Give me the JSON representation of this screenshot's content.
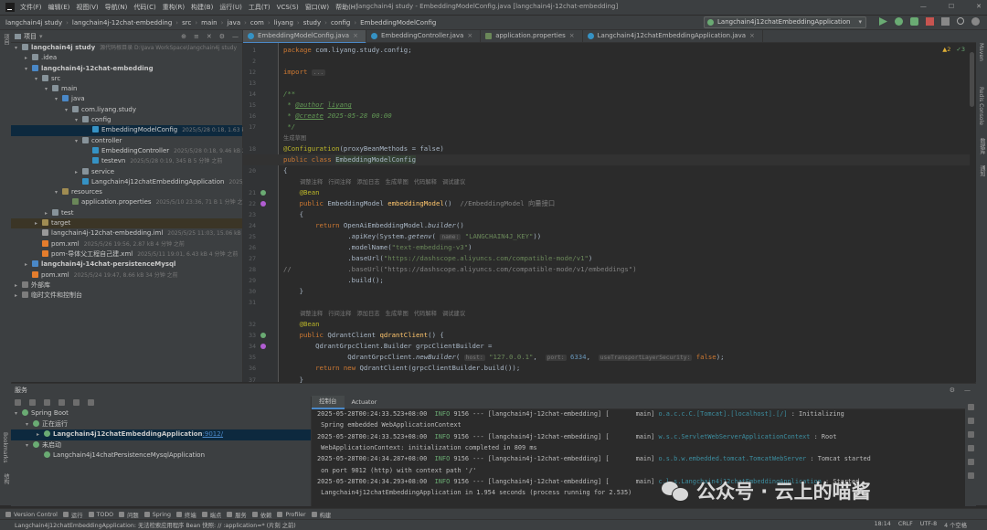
{
  "topbar": {
    "menu": [
      "文件(F)",
      "编辑(E)",
      "视图(V)",
      "导航(N)",
      "代码(C)",
      "重构(R)",
      "构建(B)",
      "运行(U)",
      "工具(T)",
      "VCS(S)",
      "窗口(W)",
      "帮助(H)"
    ],
    "title": "langchain4j study - EmbeddingModelConfig.java [langchain4j-12chat-embedding]"
  },
  "breadcrumb": [
    "langchain4j study",
    "langchain4j-12chat-embedding",
    "src",
    "main",
    "java",
    "com",
    "liyang",
    "study",
    "config",
    "EmbeddingModelConfig"
  ],
  "run_config": "Langchain4j12chatEmbeddingApplication",
  "project": {
    "header": "项目",
    "rows": [
      {
        "label": "langchain4j study",
        "meta": "源代码根目录  D:\\Java WorkSpace\\langchain4j study",
        "indent": 0,
        "arrow": "▾",
        "icon": "folder",
        "bold": true
      },
      {
        "label": ".idea",
        "meta": "",
        "indent": 1,
        "arrow": "▸",
        "icon": "folder"
      },
      {
        "label": "langchain4j-12chat-embedding",
        "meta": "",
        "indent": 1,
        "arrow": "▾",
        "icon": "mod",
        "bold": true
      },
      {
        "label": "src",
        "meta": "",
        "indent": 2,
        "arrow": "▾",
        "icon": "folder"
      },
      {
        "label": "main",
        "meta": "",
        "indent": 3,
        "arrow": "▾",
        "icon": "folder"
      },
      {
        "label": "java",
        "meta": "",
        "indent": 4,
        "arrow": "▾",
        "icon": "src"
      },
      {
        "label": "com.liyang.study",
        "meta": "",
        "indent": 5,
        "arrow": "▾",
        "icon": "folder"
      },
      {
        "label": "config",
        "meta": "",
        "indent": 6,
        "arrow": "▾",
        "icon": "folder"
      },
      {
        "label": "EmbeddingModelConfig",
        "meta": "2025/5/28 0:18, 1.63 kB 2 分钟 之前",
        "indent": 7,
        "arrow": "",
        "icon": "cls",
        "selected": true
      },
      {
        "label": "controller",
        "meta": "",
        "indent": 6,
        "arrow": "▾",
        "icon": "folder"
      },
      {
        "label": "EmbeddingController",
        "meta": "2025/5/28 0:18, 9.46 kB 2 分钟 之前",
        "indent": 7,
        "arrow": "",
        "icon": "cls"
      },
      {
        "label": "testevn",
        "meta": "2025/5/28 0:19, 345 B 5 分钟 之前",
        "indent": 7,
        "arrow": "",
        "icon": "cls"
      },
      {
        "label": "service",
        "meta": "",
        "indent": 6,
        "arrow": "▸",
        "icon": "folder"
      },
      {
        "label": "Langchain4j12chatEmbeddingApplication",
        "meta": "2025/5/26 0:",
        "indent": 6,
        "arrow": "",
        "icon": "cls"
      },
      {
        "label": "resources",
        "meta": "",
        "indent": 4,
        "arrow": "▾",
        "icon": "res"
      },
      {
        "label": "application.properties",
        "meta": "2025/5/10 23:36, 71 B 1 分钟 之前",
        "indent": 5,
        "arrow": "",
        "icon": "props"
      },
      {
        "label": "test",
        "meta": "",
        "indent": 3,
        "arrow": "▸",
        "icon": "folder"
      },
      {
        "label": "target",
        "meta": "",
        "indent": 2,
        "arrow": "▸",
        "icon": "res",
        "target": true
      },
      {
        "label": "langchain4j-12chat-embedding.iml",
        "meta": "2025/5/25 11:03, 15.06 kB",
        "indent": 2,
        "arrow": "",
        "icon": "iml"
      },
      {
        "label": "pom.xml",
        "meta": "2025/5/26 19:56, 2.87 kB 4 分钟 之前",
        "indent": 2,
        "arrow": "",
        "icon": "xml"
      },
      {
        "label": "pom-导体父工程自己建.xml",
        "meta": "2025/5/11 19:01, 6.43 kB 4 分钟 之前",
        "indent": 2,
        "arrow": "",
        "icon": "xml"
      },
      {
        "label": "langchain4j-14chat-persistenceMysql",
        "meta": "",
        "indent": 1,
        "arrow": "▸",
        "icon": "mod",
        "bold": true
      },
      {
        "label": "pom.xml",
        "meta": "2025/5/24 19:47, 8.66 kB 34 分钟 之前",
        "indent": 1,
        "arrow": "",
        "icon": "xml"
      },
      {
        "label": "外部库",
        "meta": "",
        "indent": 0,
        "arrow": "▸",
        "icon": "lib"
      },
      {
        "label": "临时文件和控制台",
        "meta": "",
        "indent": 0,
        "arrow": "▸",
        "icon": "lib"
      }
    ]
  },
  "tabs": [
    {
      "label": "EmbeddingModelConfig.java",
      "active": true,
      "kind": "cls"
    },
    {
      "label": "EmbeddingController.java",
      "active": false,
      "kind": "cls"
    },
    {
      "label": "application.properties",
      "active": false,
      "kind": "props"
    },
    {
      "label": "Langchain4j12chatEmbeddingApplication.java",
      "active": false,
      "kind": "cls"
    }
  ],
  "editor": {
    "inspections": {
      "warnings": "2",
      "ok": "3"
    },
    "line_numbers": [
      "1",
      "2",
      "12",
      "13",
      "14",
      "15",
      "16",
      "17",
      "18",
      "19",
      "20",
      "21",
      "22",
      "23",
      "24",
      "25",
      "26",
      "27",
      "28",
      "29",
      "30",
      "31",
      "32",
      "33",
      "34",
      "35",
      "36",
      "37"
    ],
    "code": {
      "package": "com.liyang.study.config;",
      "import_fold": "...",
      "author_tag": "@author",
      "author": "liyang",
      "create_tag": "@create",
      "create": "2025-05-28 00:00",
      "gen_hint": "生成草图",
      "config_ann": "@Configuration",
      "config_args": "(proxyBeanMethods = false)",
      "class_name": "EmbeddingModelConfig",
      "lens": [
        "调整注释",
        "行间注释",
        "添加日志",
        "生成草图",
        "代码解释",
        "调试建议"
      ],
      "bean": "@Bean",
      "method1": "embeddingModel",
      "method1_comment": "//EmbeddingModel 向量接口",
      "builder_cls": "OpenAiEmbeddingModel",
      "api_key_hint": "name:",
      "api_key": "\"LANGCHAIN4J_KEY\"",
      "model_name": "\"text-embedding-v3\"",
      "base_url": "\"https://dashscope.aliyuncs.com/compatible-mode/v1\"",
      "base_url2": "\"https://dashscope.aliyuncs.com/compatible-mode/v1/embeddings\"",
      "method2": "qdrantClient",
      "host_hint": "host:",
      "host": "\"127.0.0.1\"",
      "port_hint": "port:",
      "port": "6334",
      "tls_hint": "useTransportLayerSecurity:"
    }
  },
  "services": {
    "header": "服务",
    "tree": [
      {
        "label": "Spring Boot",
        "indent": 0,
        "arrow": "▾"
      },
      {
        "label": "正在运行",
        "indent": 1,
        "arrow": "▾"
      },
      {
        "label": "Langchain4j12chatEmbeddingApplication",
        "port": ":9012/",
        "indent": 2,
        "arrow": "▸",
        "selected": true,
        "bold": true
      },
      {
        "label": "未启动",
        "indent": 1,
        "arrow": "▾"
      },
      {
        "label": "Langchain4j14chatPersistenceMysqlApplication",
        "indent": 2,
        "arrow": ""
      }
    ],
    "console_tabs": [
      "控制台",
      "Actuator"
    ],
    "log": [
      {
        "ts": "2025-05-28T00:24:33.523+08:00",
        "level": "INFO",
        "pid": "9156",
        "app": "--- [langchain4j-12chat-embedding] [",
        "thread": "main]",
        "cls": "o.a.c.c.C.[Tomcat].[localhost].[/]",
        "msg": ": Initializing"
      },
      {
        "cont": " Spring embedded WebApplicationContext"
      },
      {
        "ts": "2025-05-28T00:24:33.523+08:00",
        "level": "INFO",
        "pid": "9156",
        "app": "--- [langchain4j-12chat-embedding] [",
        "thread": "main]",
        "cls": "w.s.c.ServletWebServerApplicationContext",
        "msg": ": Root"
      },
      {
        "cont": " WebApplicationContext: initialization completed in 809 ms"
      },
      {
        "ts": "2025-05-28T00:24:34.287+08:00",
        "level": "INFO",
        "pid": "9156",
        "app": "--- [langchain4j-12chat-embedding] [",
        "thread": "main]",
        "cls": "o.s.b.w.embedded.tomcat.TomcatWebServer",
        "msg": ": Tomcat started"
      },
      {
        "cont": " on port 9012 (http) with context path '/'"
      },
      {
        "ts": "2025-05-28T00:24:34.293+08:00",
        "level": "INFO",
        "pid": "9156",
        "app": "--- [langchain4j-12chat-embedding] [",
        "thread": "main]",
        "cls": "c.l.s.Langchain4j12chatEmbeddingApplication",
        "msg": ": Started"
      },
      {
        "cont": " Langchain4j12chatEmbeddingApplication in 1.954 seconds (process running for 2.535)"
      }
    ]
  },
  "tool_tabs": [
    "Version Control",
    "运行",
    "TODO",
    "问题",
    "Spring",
    "终端",
    "端点",
    "服务",
    "依赖",
    "Profiler",
    "构建"
  ],
  "status": {
    "message": "Langchain4j12chatEmbeddingApplication: 无法检索应用程序 Bean 快照: // :application=* (片刻 之前)",
    "time": "18:14",
    "crlf": "CRLF",
    "encoding": "UTF-8",
    "indent": "4 个空格"
  },
  "side_tabs": {
    "left": [
      "项目",
      "书签",
      "Bookmarks",
      "结构"
    ],
    "right": [
      "Maven",
      "Redis Console",
      "数据库",
      "通知"
    ]
  },
  "watermark": "公众号 · 云上的喵酱"
}
